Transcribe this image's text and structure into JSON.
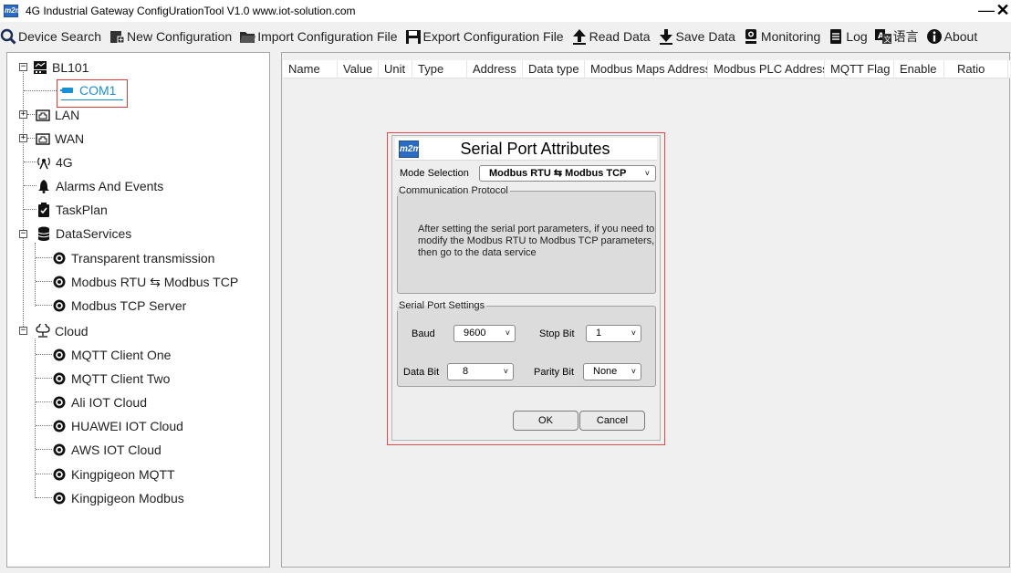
{
  "window": {
    "title": "4G Industrial Gateway ConfigUrationTool V1.0 www.iot-solution.com",
    "app_icon_text": "m2m",
    "minimize_glyph": "—",
    "close_glyph": "✕"
  },
  "toolbar": {
    "device_search": "Device Search",
    "new_configuration": "New Configuration",
    "import_configuration": "Import Configuration File",
    "export_configuration": "Export Configuration File",
    "read_data": "Read Data",
    "save_data": "Save Data",
    "monitoring": "Monitoring",
    "log": "Log",
    "language": "语言",
    "about": "About"
  },
  "tree": {
    "root": "BL101",
    "com1": "COM1",
    "lan": "LAN",
    "wan": "WAN",
    "g4": "4G",
    "alarms": "Alarms And Events",
    "taskplan": "TaskPlan",
    "dataservices": "DataServices",
    "transparent": "Transparent transmission",
    "modbus_rtu_tcp": "Modbus RTU ⇆ Modbus TCP",
    "modbus_tcp_server": "Modbus TCP Server",
    "cloud": "Cloud",
    "mqtt_one": "MQTT Client One",
    "mqtt_two": "MQTT Client Two",
    "ali": "Ali IOT Cloud",
    "huawei": "HUAWEI IOT Cloud",
    "aws": "AWS IOT Cloud",
    "kp_mqtt": "Kingpigeon MQTT",
    "kp_modbus": "Kingpigeon Modbus"
  },
  "table": {
    "columns": [
      "Name",
      "Value",
      "Unit",
      "Type",
      "Address",
      "Data type",
      "Modbus Maps Address",
      "Modbus PLC Address",
      "MQTT Flag",
      "Enable",
      "Ratio"
    ]
  },
  "dialog": {
    "title": "Serial Port Attributes",
    "mode_label": "Mode Selection",
    "mode_value": "Modbus RTU ⇆ Modbus TCP",
    "protocol_legend": "Communication Protocol",
    "protocol_text": "After setting the serial port parameters, if you need to modify the Modbus RTU to Modbus TCP parameters, then go to the data service",
    "serial_legend": "Serial Port Settings",
    "baud_label": "Baud",
    "baud_value": "9600",
    "stopbit_label": "Stop Bit",
    "stopbit_value": "1",
    "databit_label": "Data Bit",
    "databit_value": "8",
    "parity_label": "Parity Bit",
    "parity_value": "None",
    "ok": "OK",
    "cancel": "Cancel",
    "dropdown_glyph": "˅"
  },
  "colors": {
    "accent_blue": "#1a8fd6",
    "selection_red": "#e23b3b",
    "app_icon_blue": "#2a6bc4"
  }
}
